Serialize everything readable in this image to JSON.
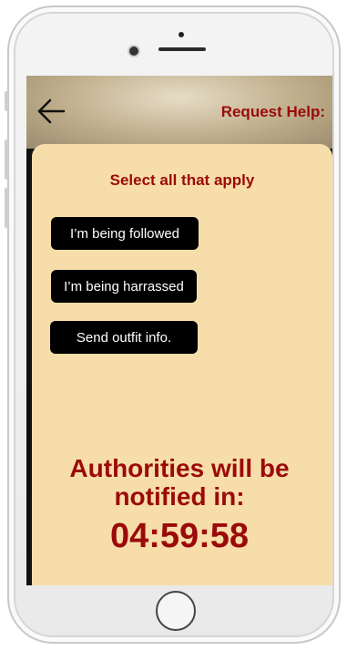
{
  "header": {
    "title": "Request Help:",
    "back_icon": "back-arrow-icon"
  },
  "panel": {
    "heading": "Select all that apply",
    "options": [
      {
        "label": "I’m being followed"
      },
      {
        "label": "I’m being harrassed"
      },
      {
        "label": "Send outfit info."
      }
    ]
  },
  "notice": {
    "line1": "Authorities will be",
    "line2": "notified in:",
    "countdown": "04:59:58"
  },
  "colors": {
    "accent_text": "#9b0a0a",
    "panel_bg": "#f7ddaa",
    "button_bg": "#000000"
  }
}
